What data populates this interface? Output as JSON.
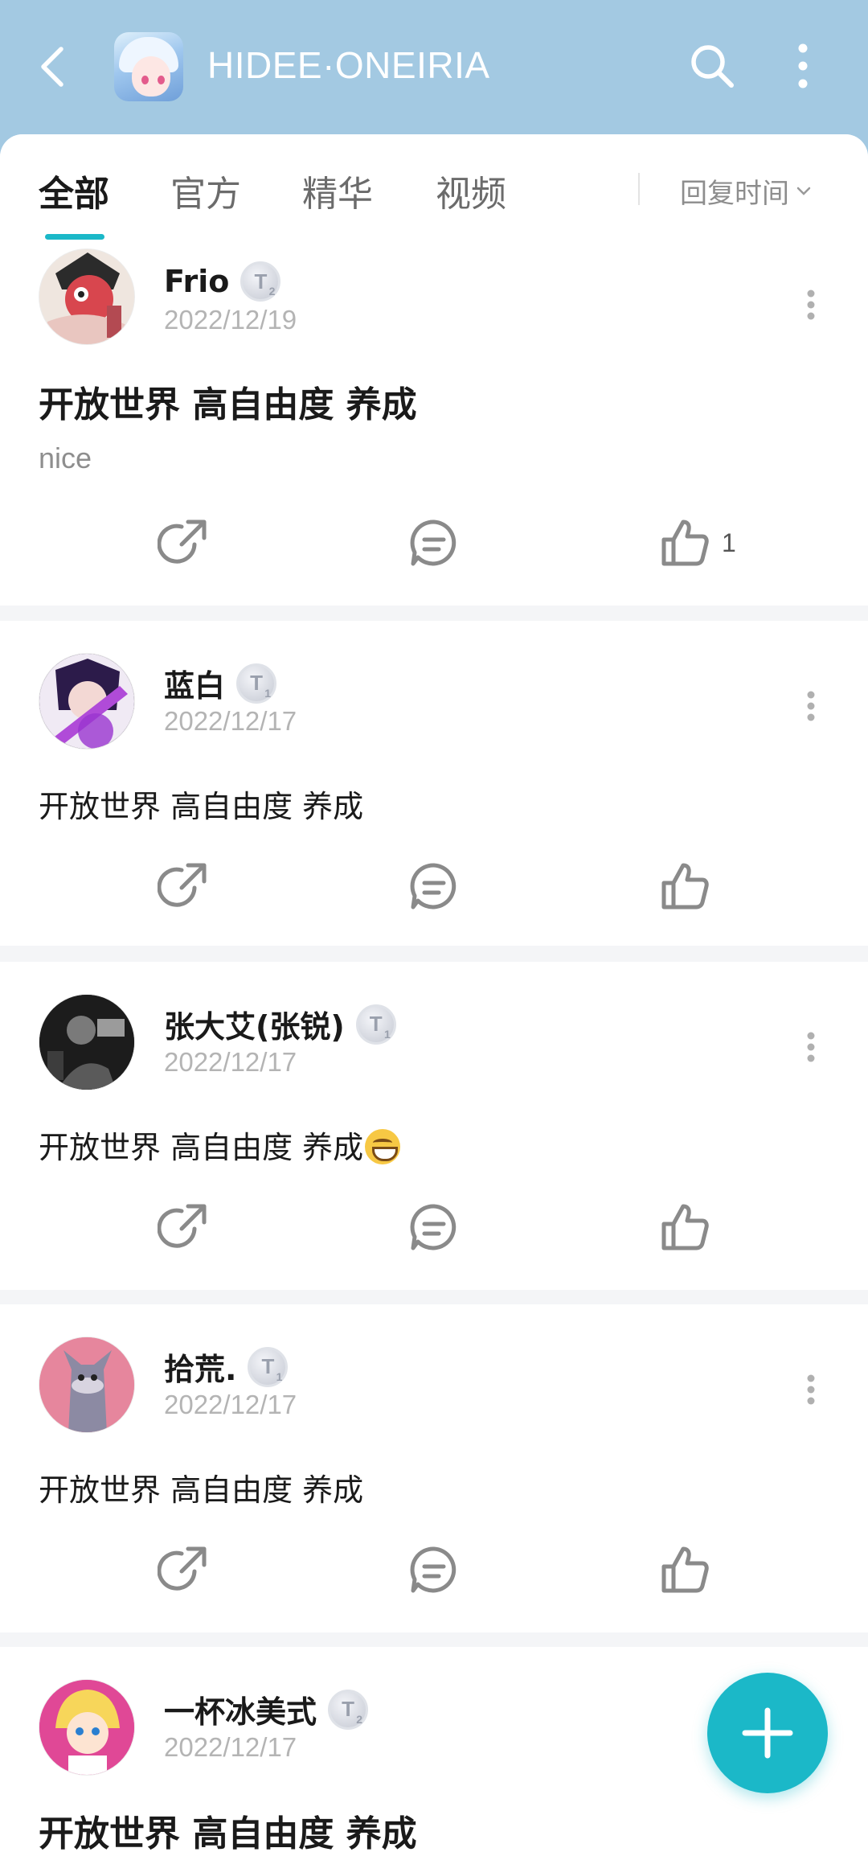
{
  "header": {
    "title": "HIDEE·ONEIRIA",
    "back_icon": "chevron-left-icon",
    "search_icon": "search-icon",
    "more_icon": "more-vertical-icon"
  },
  "tabs": [
    {
      "label": "全部",
      "active": true
    },
    {
      "label": "官方",
      "active": false
    },
    {
      "label": "精华",
      "active": false
    },
    {
      "label": "视频",
      "active": false
    }
  ],
  "sort": {
    "label": "回复时间"
  },
  "posts": [
    {
      "author": "Frio",
      "level": "T",
      "level_num": "2",
      "date": "2022/12/19",
      "title": "开放世界 高自由度 养成",
      "body": "nice",
      "likes": "1"
    },
    {
      "author": "蓝白",
      "level": "T",
      "level_num": "1",
      "date": "2022/12/17",
      "body": "开放世界 高自由度 养成"
    },
    {
      "author": "张大艾(张锐)",
      "level": "T",
      "level_num": "1",
      "date": "2022/12/17",
      "body": "开放世界 高自由度 养成",
      "emoji": "grinning-face"
    },
    {
      "author": "拾荒.",
      "level": "T",
      "level_num": "1",
      "date": "2022/12/17",
      "body": "开放世界 高自由度 养成"
    },
    {
      "author": "一杯冰美式",
      "level": "T",
      "level_num": "2",
      "date": "2022/12/17",
      "title": "开放世界 高自由度 养成"
    }
  ],
  "colors": {
    "accent": "#1bb8c8",
    "header_bg": "#a3c9e2"
  },
  "fab_icon": "plus-icon"
}
